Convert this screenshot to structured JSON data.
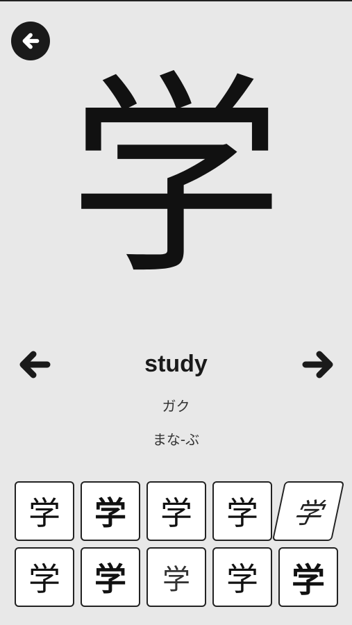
{
  "kanji": "学",
  "meaning": "study",
  "on_reading": "ガク",
  "kun_reading": "まな-ぶ",
  "font_samples": [
    {
      "glyph": "学",
      "style": "serif-thin"
    },
    {
      "glyph": "学",
      "style": "bold"
    },
    {
      "glyph": "学",
      "style": "sans"
    },
    {
      "glyph": "学",
      "style": "serif"
    },
    {
      "glyph": "学",
      "style": "cursive"
    },
    {
      "glyph": "学",
      "style": "serif-thin"
    },
    {
      "glyph": "学",
      "style": "bold"
    },
    {
      "glyph": "学",
      "style": "light"
    },
    {
      "glyph": "学",
      "style": "serif"
    },
    {
      "glyph": "学",
      "style": "heavy"
    }
  ],
  "icons": {
    "back": "back-arrow-circle-icon",
    "prev": "arrow-left-icon",
    "next": "arrow-right-icon"
  },
  "colors": {
    "background": "#e8e8e8",
    "foreground": "#1a1a1a",
    "tile": "#ffffff"
  }
}
